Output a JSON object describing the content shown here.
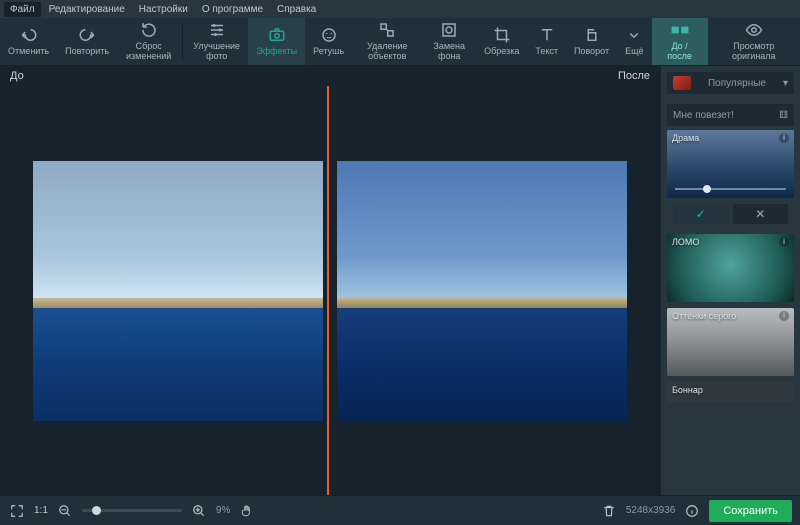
{
  "menu": {
    "file": "Файл",
    "edit": "Редактирование",
    "settings": "Настройки",
    "about": "О программе",
    "help": "Справка"
  },
  "toolbar": {
    "undo": "Отменить",
    "redo": "Повторить",
    "reset": "Сброс изменений",
    "enhance": "Улучшение фото",
    "effects": "Эффекты",
    "retouch": "Ретушь",
    "removeObj": "Удаление объектов",
    "replaceBg": "Замена фона",
    "crop": "Обрезка",
    "text": "Текст",
    "rotate": "Поворот",
    "more": "Ещё",
    "beforeAfter": "До / после",
    "viewOriginal": "Просмотр оригинала"
  },
  "canvas": {
    "before": "До",
    "after": "После"
  },
  "sidebar": {
    "category": "Популярные",
    "lucky": "Мне повезет!",
    "presets": {
      "drama": "Драма",
      "lomo": "ЛОМО",
      "gray": "Оттенки серого",
      "bonnard": "Боннар"
    },
    "apply": "✓",
    "cancel": "✕"
  },
  "status": {
    "fit": "1:1",
    "zoom": "9%",
    "dimensions": "5248x3936",
    "save": "Сохранить"
  }
}
